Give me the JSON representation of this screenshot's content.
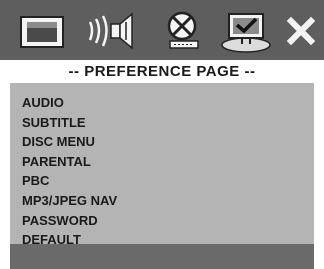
{
  "toolbar": {
    "icons": [
      "display-icon",
      "speaker-icon",
      "disc-icon",
      "preference-icon",
      "close-icon"
    ],
    "selected": "preference-icon"
  },
  "page": {
    "title": "-- PREFERENCE PAGE --"
  },
  "menu": {
    "items": [
      {
        "label": "AUDIO"
      },
      {
        "label": "SUBTITLE"
      },
      {
        "label": "DISC MENU"
      },
      {
        "label": "PARENTAL"
      },
      {
        "label": "PBC"
      },
      {
        "label": "MP3/JPEG NAV"
      },
      {
        "label": "PASSWORD"
      },
      {
        "label": "DEFAULT"
      }
    ]
  },
  "colors": {
    "toolbar_bg": "#5e5e5e",
    "panel_bg": "#b4b4b4",
    "bottom_bar": "#6a6a6a",
    "text": "#1a1a1a"
  }
}
